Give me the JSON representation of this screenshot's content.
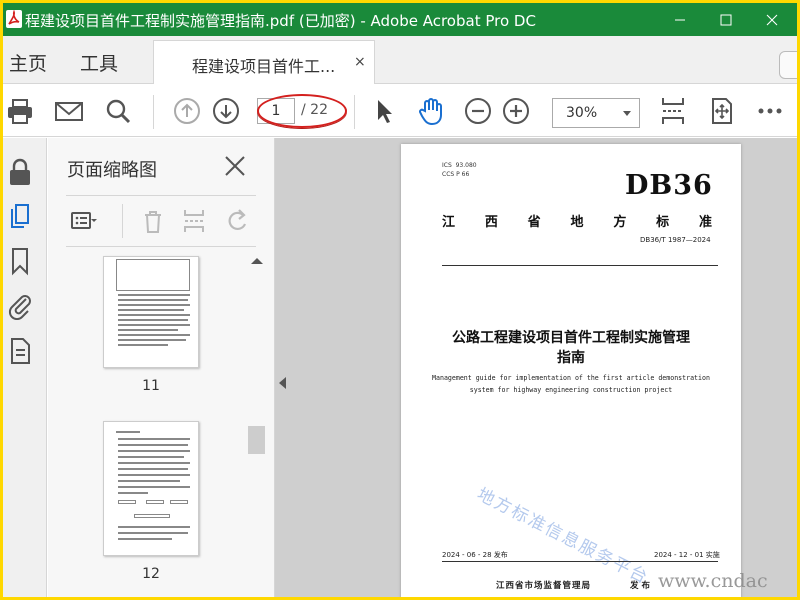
{
  "window": {
    "title": "程建设项目首件工程制实施管理指南.pdf (已加密) - Adobe Acrobat Pro DC",
    "colors": {
      "title_bar": "#1a8a3a",
      "annotation": "#d4201e",
      "watermark": "#a7c0ea"
    }
  },
  "menu": {
    "home": "主页",
    "tools": "工具"
  },
  "tab": {
    "label": "程建设项目首件工...",
    "close": "×"
  },
  "toolbar": {
    "page_current": "1",
    "page_total": "/ 22",
    "zoom": "30%",
    "icons": [
      "print-icon",
      "email-icon",
      "search-icon",
      "previous-page-icon",
      "next-page-icon",
      "select-cursor-icon",
      "hand-icon",
      "zoom-out-icon",
      "zoom-in-icon",
      "scroll-mode-icon",
      "fit-page-icon",
      "more-icon"
    ]
  },
  "sidebar": {
    "icons": [
      "lock-icon",
      "page-thumbnails-icon",
      "bookmark-icon",
      "attachment-icon",
      "document-icon"
    ],
    "panel_title": "页面缩略图",
    "thumbnails": [
      {
        "label": "11"
      },
      {
        "label": "12"
      }
    ]
  },
  "document": {
    "ics": "ICS  93.080\nCCS P 66",
    "code": "DB36",
    "standard_name_chars": [
      "江",
      "西",
      "省",
      "地",
      "方",
      "标",
      "准"
    ],
    "standard_number": "DB36/T 1987—2024",
    "title_cn_line1": "公路工程建设项目首件工程制实施管理",
    "title_cn_line2": "指南",
    "title_en_line1": "Management guide for implementation of the first article demonstration",
    "title_en_line2": "system for highway engineering construction project",
    "watermark": "地方标准信息服务平台",
    "publish_date": "2024 - 06 - 28 发布",
    "implement_date": "2024 - 12 - 01 实施",
    "issuer": "江西省市场监督管理局",
    "issue_label": "发 布",
    "site_watermark": "www.cndac"
  }
}
